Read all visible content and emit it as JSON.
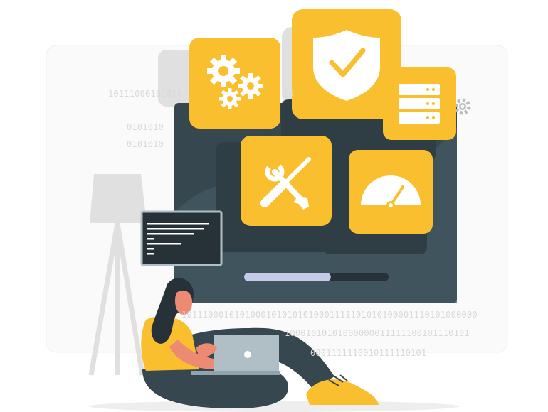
{
  "illustration": {
    "binary_lines": [
      "10111000101010",
      "10",
      "0101010",
      "0101010",
      "10111000101010001010101010001111101010100001110101000000",
      "10001010101000000011111100101110101",
      "0001111110010111110101"
    ],
    "progress": 0.6,
    "colors": {
      "accent": "#f9bf2f",
      "dark": "#37474f",
      "light_gray": "#ebebeb",
      "skin": "#ed8a74"
    }
  }
}
